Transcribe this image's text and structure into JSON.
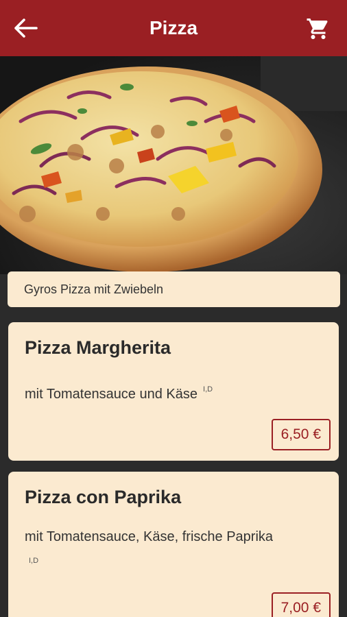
{
  "header": {
    "title": "Pizza",
    "back_icon": "arrow-left-icon",
    "cart_icon": "shopping-cart-icon",
    "color": "#9a1f23"
  },
  "hero": {
    "caption": "Gyros Pizza mit Zwiebeln"
  },
  "menu": [
    {
      "name": "Pizza Margherita",
      "description": "mit Tomatensauce und Käse",
      "allergens": "I,D",
      "price": "6,50 €"
    },
    {
      "name": "Pizza con Paprika",
      "description": "mit Tomatensauce, Käse, frische Paprika",
      "allergens": "I,D",
      "price": "7,00 €"
    }
  ]
}
